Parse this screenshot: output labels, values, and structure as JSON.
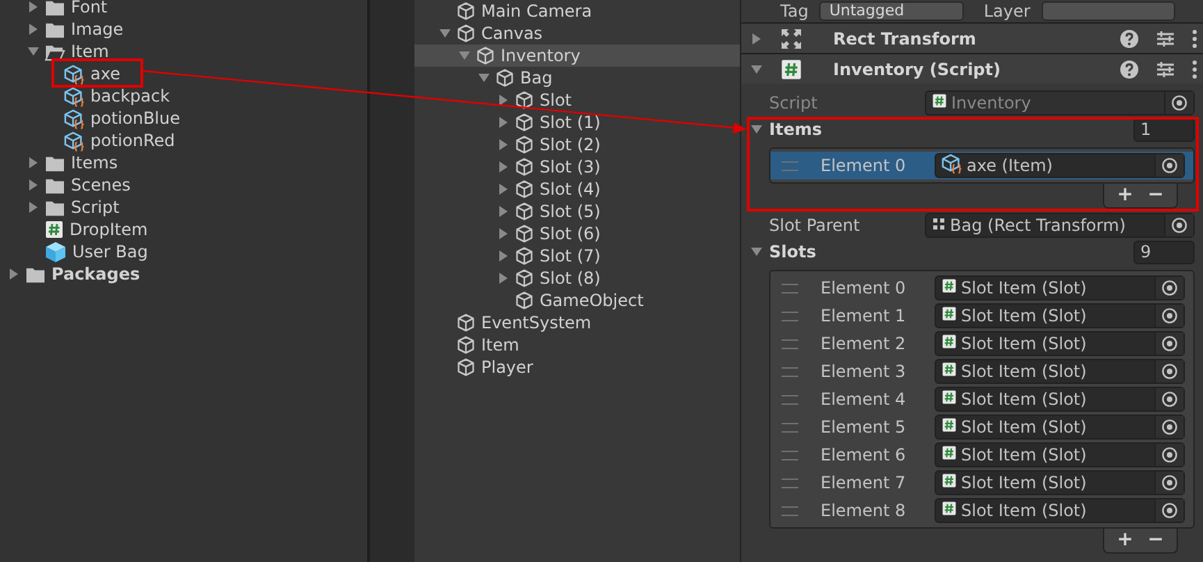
{
  "project": {
    "tree": [
      {
        "label": "Font",
        "kind": "folder",
        "expanded": false
      },
      {
        "label": "Image",
        "kind": "folder",
        "expanded": false
      },
      {
        "label": "Item",
        "kind": "folder",
        "expanded": true,
        "children": [
          {
            "label": "axe",
            "kind": "prefab"
          },
          {
            "label": "backpack",
            "kind": "prefab"
          },
          {
            "label": "potionBlue",
            "kind": "prefab"
          },
          {
            "label": "potionRed",
            "kind": "prefab"
          }
        ]
      },
      {
        "label": "Items",
        "kind": "folder",
        "expanded": false
      },
      {
        "label": "Scenes",
        "kind": "folder",
        "expanded": false
      },
      {
        "label": "Script",
        "kind": "folder",
        "expanded": false
      },
      {
        "label": "DropItem",
        "kind": "script"
      },
      {
        "label": "User Bag",
        "kind": "asset"
      }
    ],
    "packages": {
      "label": "Packages",
      "kind": "folder",
      "expanded": false
    }
  },
  "hierarchy": {
    "tree": [
      {
        "label": "Main Camera",
        "selected": false
      },
      {
        "label": "Canvas",
        "selected": false,
        "expanded": true,
        "children": [
          {
            "label": "Inventory",
            "selected": true,
            "expanded": true,
            "children": [
              {
                "label": "Bag",
                "selected": false,
                "expanded": true,
                "children": [
                  {
                    "label": "Slot",
                    "selected": false,
                    "expanded": false
                  },
                  {
                    "label": "Slot (1)",
                    "selected": false,
                    "expanded": false
                  },
                  {
                    "label": "Slot (2)",
                    "selected": false,
                    "expanded": false
                  },
                  {
                    "label": "Slot (3)",
                    "selected": false,
                    "expanded": false
                  },
                  {
                    "label": "Slot (4)",
                    "selected": false,
                    "expanded": false
                  },
                  {
                    "label": "Slot (5)",
                    "selected": false,
                    "expanded": false
                  },
                  {
                    "label": "Slot (6)",
                    "selected": false,
                    "expanded": false
                  },
                  {
                    "label": "Slot (7)",
                    "selected": false,
                    "expanded": false
                  },
                  {
                    "label": "Slot (8)",
                    "selected": false,
                    "expanded": false
                  },
                  {
                    "label": "GameObject",
                    "selected": false
                  }
                ]
              }
            ]
          }
        ]
      },
      {
        "label": "EventSystem",
        "selected": false
      },
      {
        "label": "Item",
        "selected": false
      },
      {
        "label": "Player",
        "selected": false
      }
    ]
  },
  "inspector": {
    "tag": {
      "label": "Tag",
      "value": "Untagged"
    },
    "layer": {
      "label": "Layer"
    },
    "components": [
      {
        "title": "Rect Transform",
        "kind": "rect-transform",
        "expanded": false
      },
      {
        "title": "Inventory (Script)",
        "kind": "script",
        "expanded": true,
        "fields": [
          {
            "kind": "script-ref",
            "label": "Script",
            "value": "Inventory",
            "disabled": true
          },
          {
            "kind": "list",
            "label": "Items",
            "expanded": true,
            "count": "1",
            "add": "+",
            "remove": "−",
            "elements": [
              {
                "label": "Element 0",
                "value": "axe (Item)",
                "kind": "prefab",
                "selected": true
              }
            ]
          },
          {
            "kind": "transform-ref",
            "label": "Slot Parent",
            "value": "Bag (Rect Transform)",
            "disabled": false
          },
          {
            "kind": "list",
            "label": "Slots",
            "expanded": true,
            "count": "9",
            "add": "+",
            "remove": "−",
            "elements": [
              {
                "label": "Element 0",
                "value": "Slot Item (Slot)",
                "kind": "script",
                "selected": false
              },
              {
                "label": "Element 1",
                "value": "Slot Item (Slot)",
                "kind": "script",
                "selected": false
              },
              {
                "label": "Element 2",
                "value": "Slot Item (Slot)",
                "kind": "script",
                "selected": false
              },
              {
                "label": "Element 3",
                "value": "Slot Item (Slot)",
                "kind": "script",
                "selected": false
              },
              {
                "label": "Element 4",
                "value": "Slot Item (Slot)",
                "kind": "script",
                "selected": false
              },
              {
                "label": "Element 5",
                "value": "Slot Item (Slot)",
                "kind": "script",
                "selected": false
              },
              {
                "label": "Element 6",
                "value": "Slot Item (Slot)",
                "kind": "script",
                "selected": false
              },
              {
                "label": "Element 7",
                "value": "Slot Item (Slot)",
                "kind": "script",
                "selected": false
              },
              {
                "label": "Element 8",
                "value": "Slot Item (Slot)",
                "kind": "script",
                "selected": false
              }
            ]
          }
        ]
      }
    ]
  }
}
